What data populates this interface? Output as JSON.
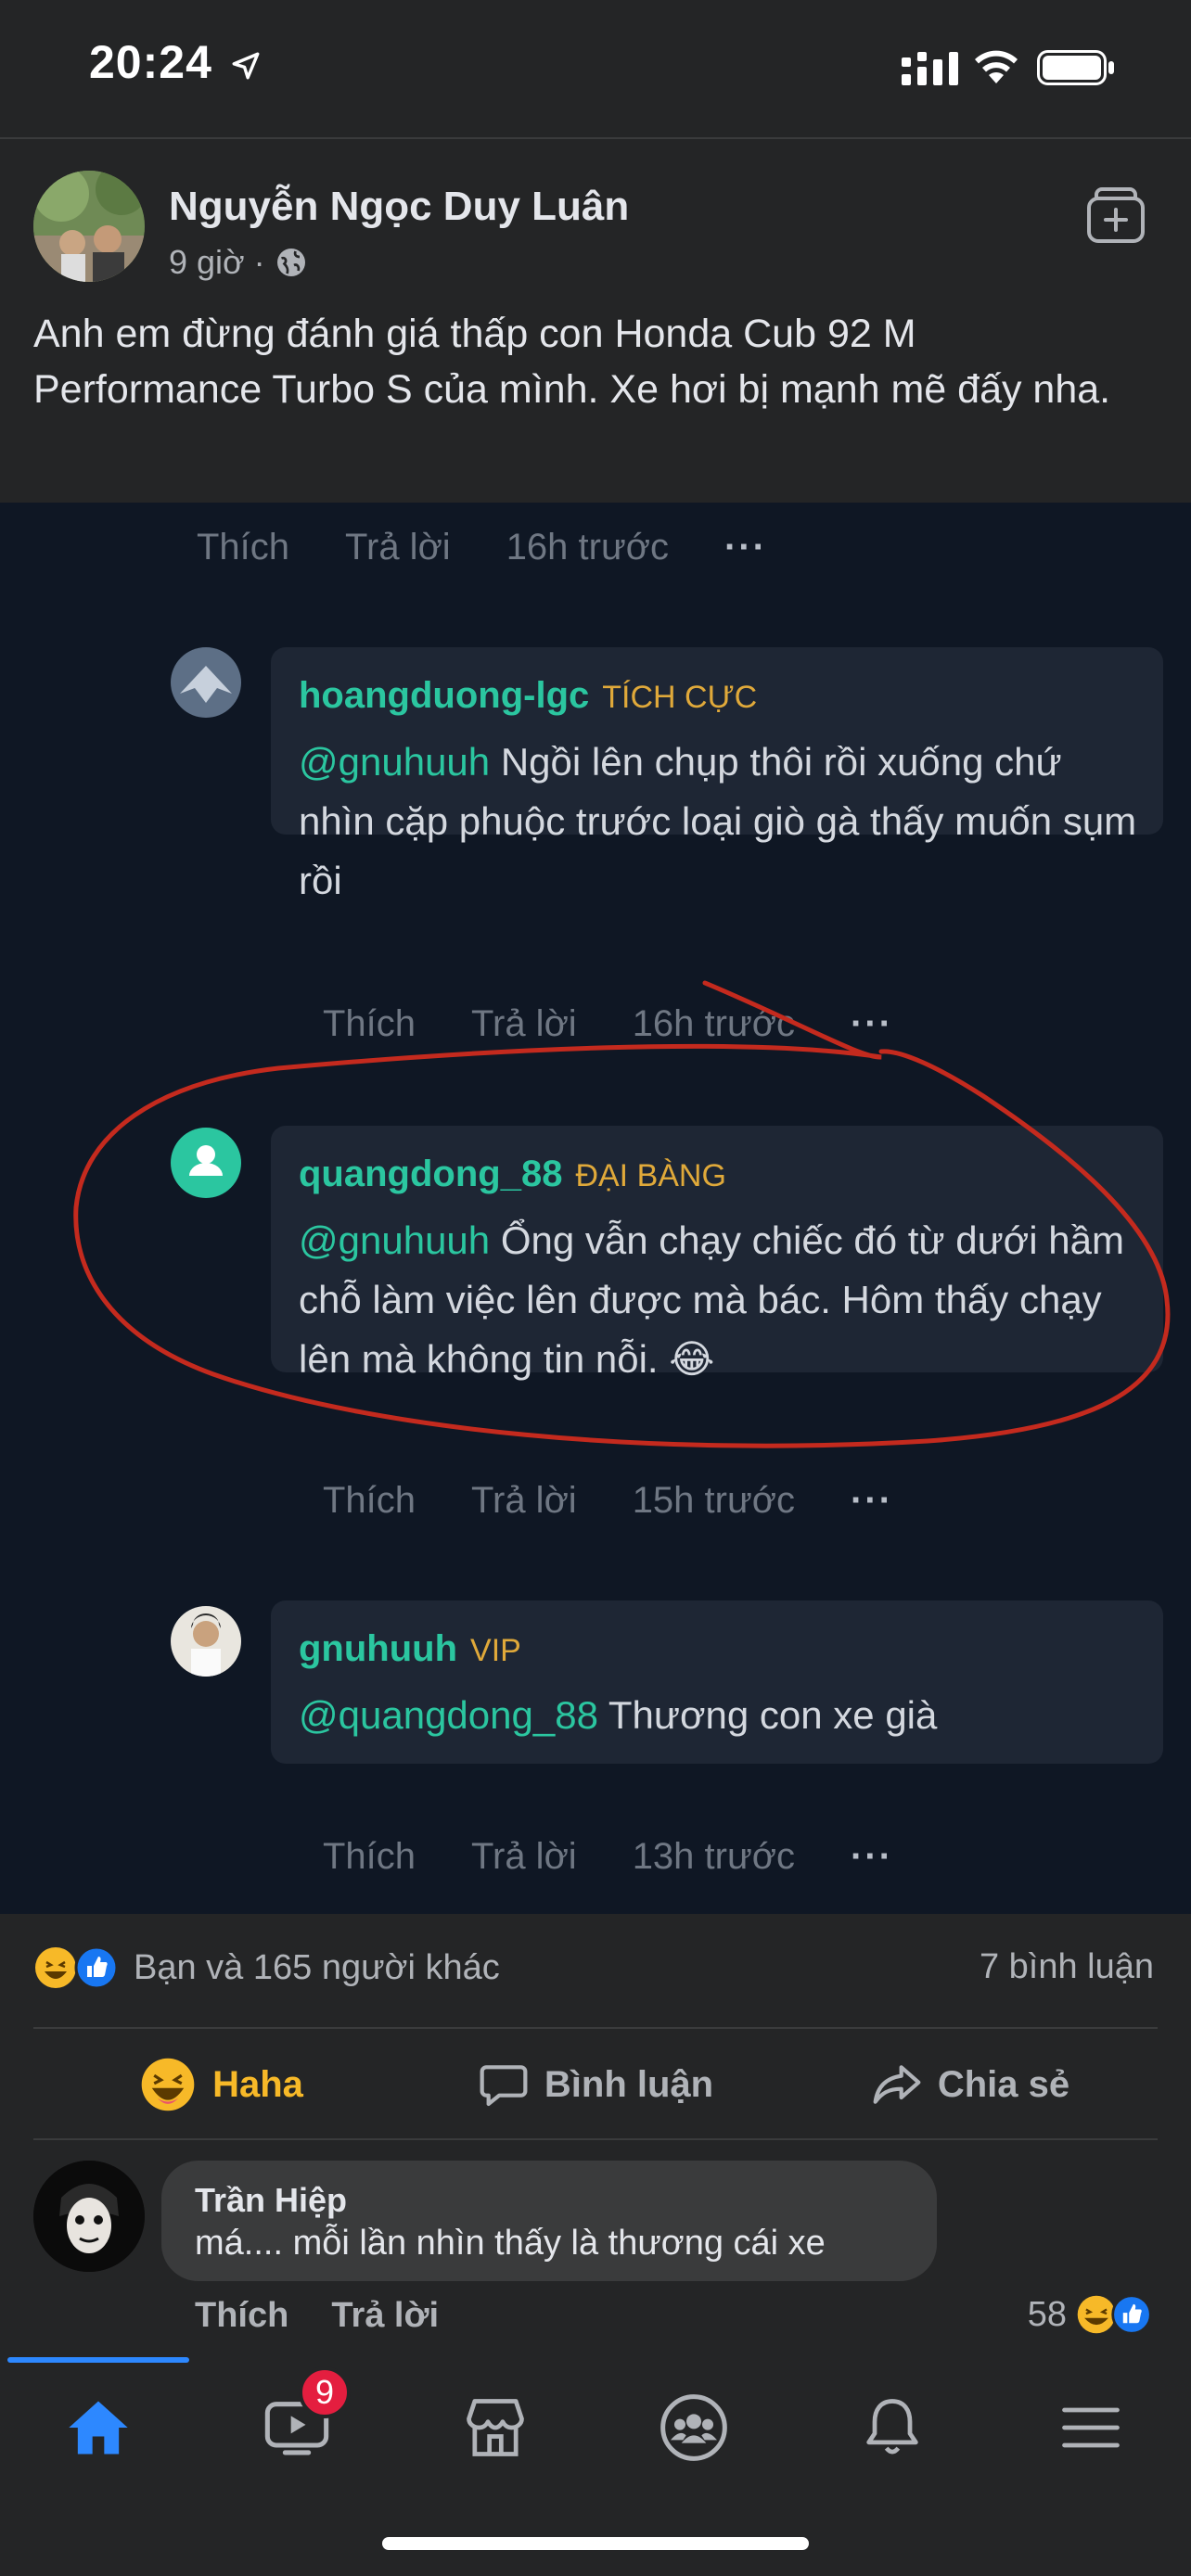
{
  "status": {
    "time": "20:24"
  },
  "post": {
    "author": "Nguyễn Ngọc Duy Luân",
    "time": "9 giờ",
    "separator": "·",
    "text": "Anh em đừng đánh giá thấp con Honda Cub 92 M Performance Turbo S của mình. Xe hơi bị mạnh mẽ đấy nha."
  },
  "screenshot": {
    "top_actions": {
      "like": "Thích",
      "reply": "Trả lời",
      "time": "16h trước",
      "more": "···"
    },
    "comments": [
      {
        "user": "hoangduong-lgc",
        "badge": "TÍCH CỰC",
        "mention": "@gnuhuuh",
        "text": " Ngồi lên chụp thôi rồi xuống chứ nhìn cặp phuộc trước loại giò gà thấy muốn sụm rồi",
        "like": "Thích",
        "reply": "Trả lời",
        "time": "16h trước",
        "more": "···"
      },
      {
        "user": "quangdong_88",
        "badge": "ĐẠI BÀNG",
        "mention": "@gnuhuuh",
        "text": " Ổng vẫn chạy chiếc đó từ dưới hầm chỗ làm việc lên được mà bác. Hôm thấy chạy lên mà không tin nỗi. 😂",
        "like": "Thích",
        "reply": "Trả lời",
        "time": "15h trước",
        "more": "···"
      },
      {
        "user": "gnuhuuh",
        "badge": "VIP",
        "mention": "@quangdong_88",
        "text": " Thương con xe già",
        "like": "Thích",
        "reply": "Trả lời",
        "time": "13h trước",
        "more": "···"
      }
    ]
  },
  "reactions": {
    "summary": "Bạn và 165 người khác",
    "comments": "7 bình luận"
  },
  "actions": {
    "haha": "Haha",
    "comment": "Bình luận",
    "share": "Chia sẻ"
  },
  "top_comment": {
    "name": "Trần Hiệp",
    "text": "má.... mỗi lần nhìn thấy là thương cái xe",
    "like": "Thích",
    "reply": "Trả lời",
    "count": "58"
  },
  "nav": {
    "video_badge": "9"
  },
  "colors": {
    "accent": "#2d88ff",
    "haha": "#f7b928",
    "teal": "#2bc6a0",
    "badge_gold": "#e0a93a",
    "annotation_red": "#c42a1e"
  }
}
